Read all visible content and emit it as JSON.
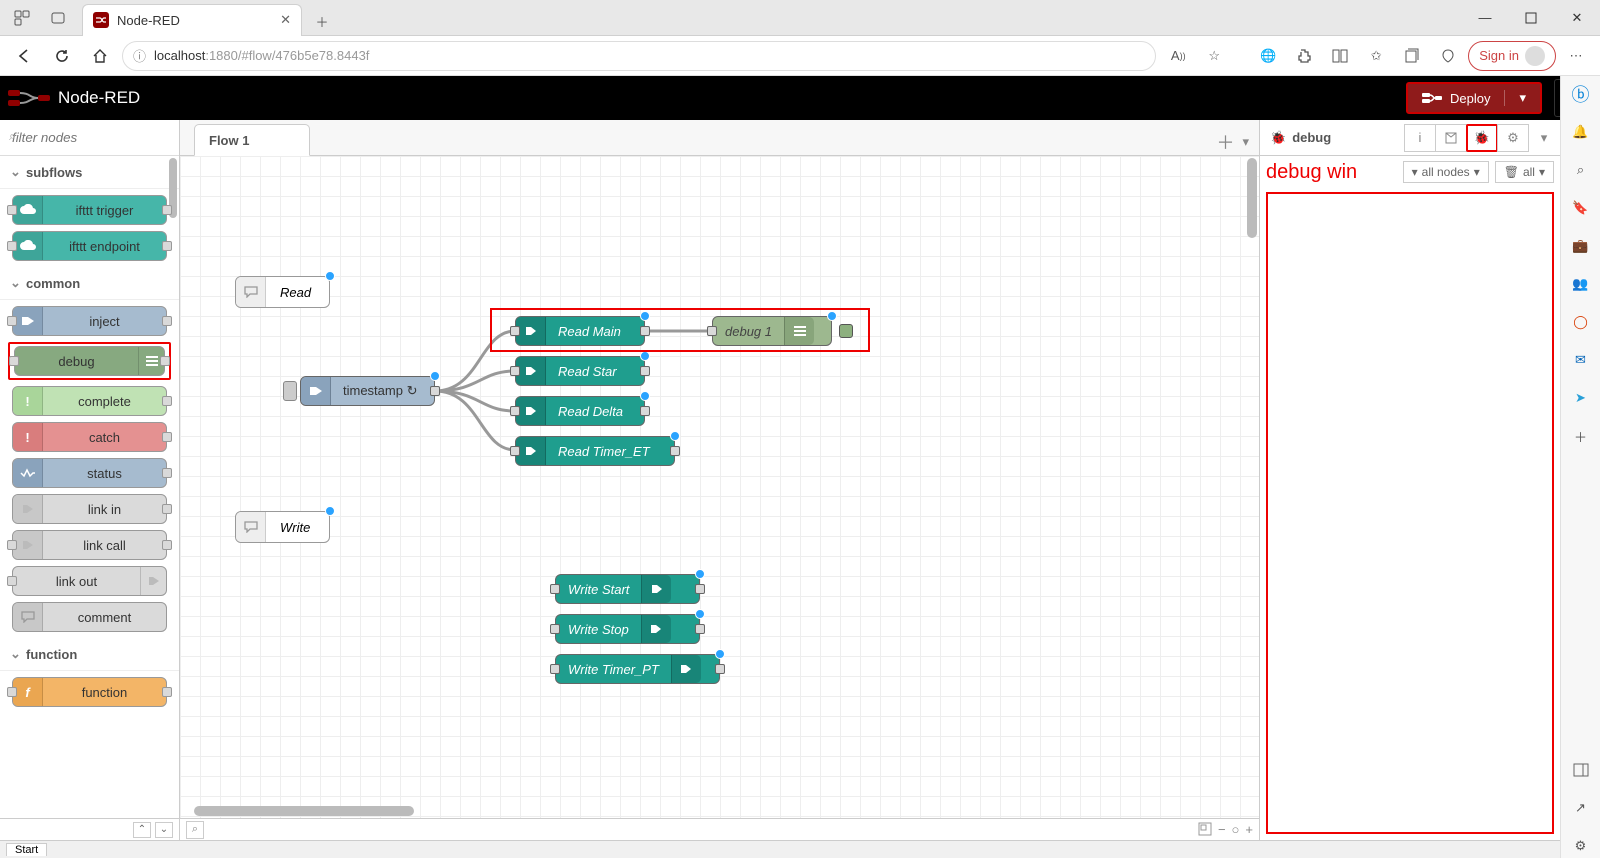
{
  "browser": {
    "tab_title": "Node-RED",
    "url_host": "localhost",
    "url_port_path": ":1880/#flow/476b5e78.8443f",
    "signin_label": "Sign in"
  },
  "header": {
    "app_name": "Node-RED",
    "deploy_label": "Deploy"
  },
  "palette": {
    "filter_placeholder": "filter nodes",
    "filter_icon_prefix": "⌕",
    "categories": {
      "subflows": "subflows",
      "common": "common",
      "function": "function"
    },
    "nodes": {
      "ifttt_trigger": "ifttt trigger",
      "ifttt_endpoint": "ifttt endpoint",
      "inject": "inject",
      "debug": "debug",
      "complete": "complete",
      "catch": "catch",
      "status": "status",
      "link_in": "link in",
      "link_call": "link call",
      "link_out": "link out",
      "comment": "comment",
      "function": "function"
    }
  },
  "workspace": {
    "tab": "Flow 1",
    "nodes": {
      "read_comment": "Read",
      "write_comment": "Write",
      "timestamp": "timestamp",
      "read_main": "Read Main",
      "read_star": "Read Star",
      "read_delta": "Read Delta",
      "read_timer_et": "Read Timer_ET",
      "debug1": "debug 1",
      "write_start": "Write Start",
      "write_stop": "Write Stop",
      "write_timer_pt": "Write Timer_PT"
    }
  },
  "sidebar": {
    "title": "debug",
    "annotation": "debug win",
    "filter_label": "all nodes",
    "clear_label": "all"
  },
  "statusbar": {
    "start": "Start"
  }
}
